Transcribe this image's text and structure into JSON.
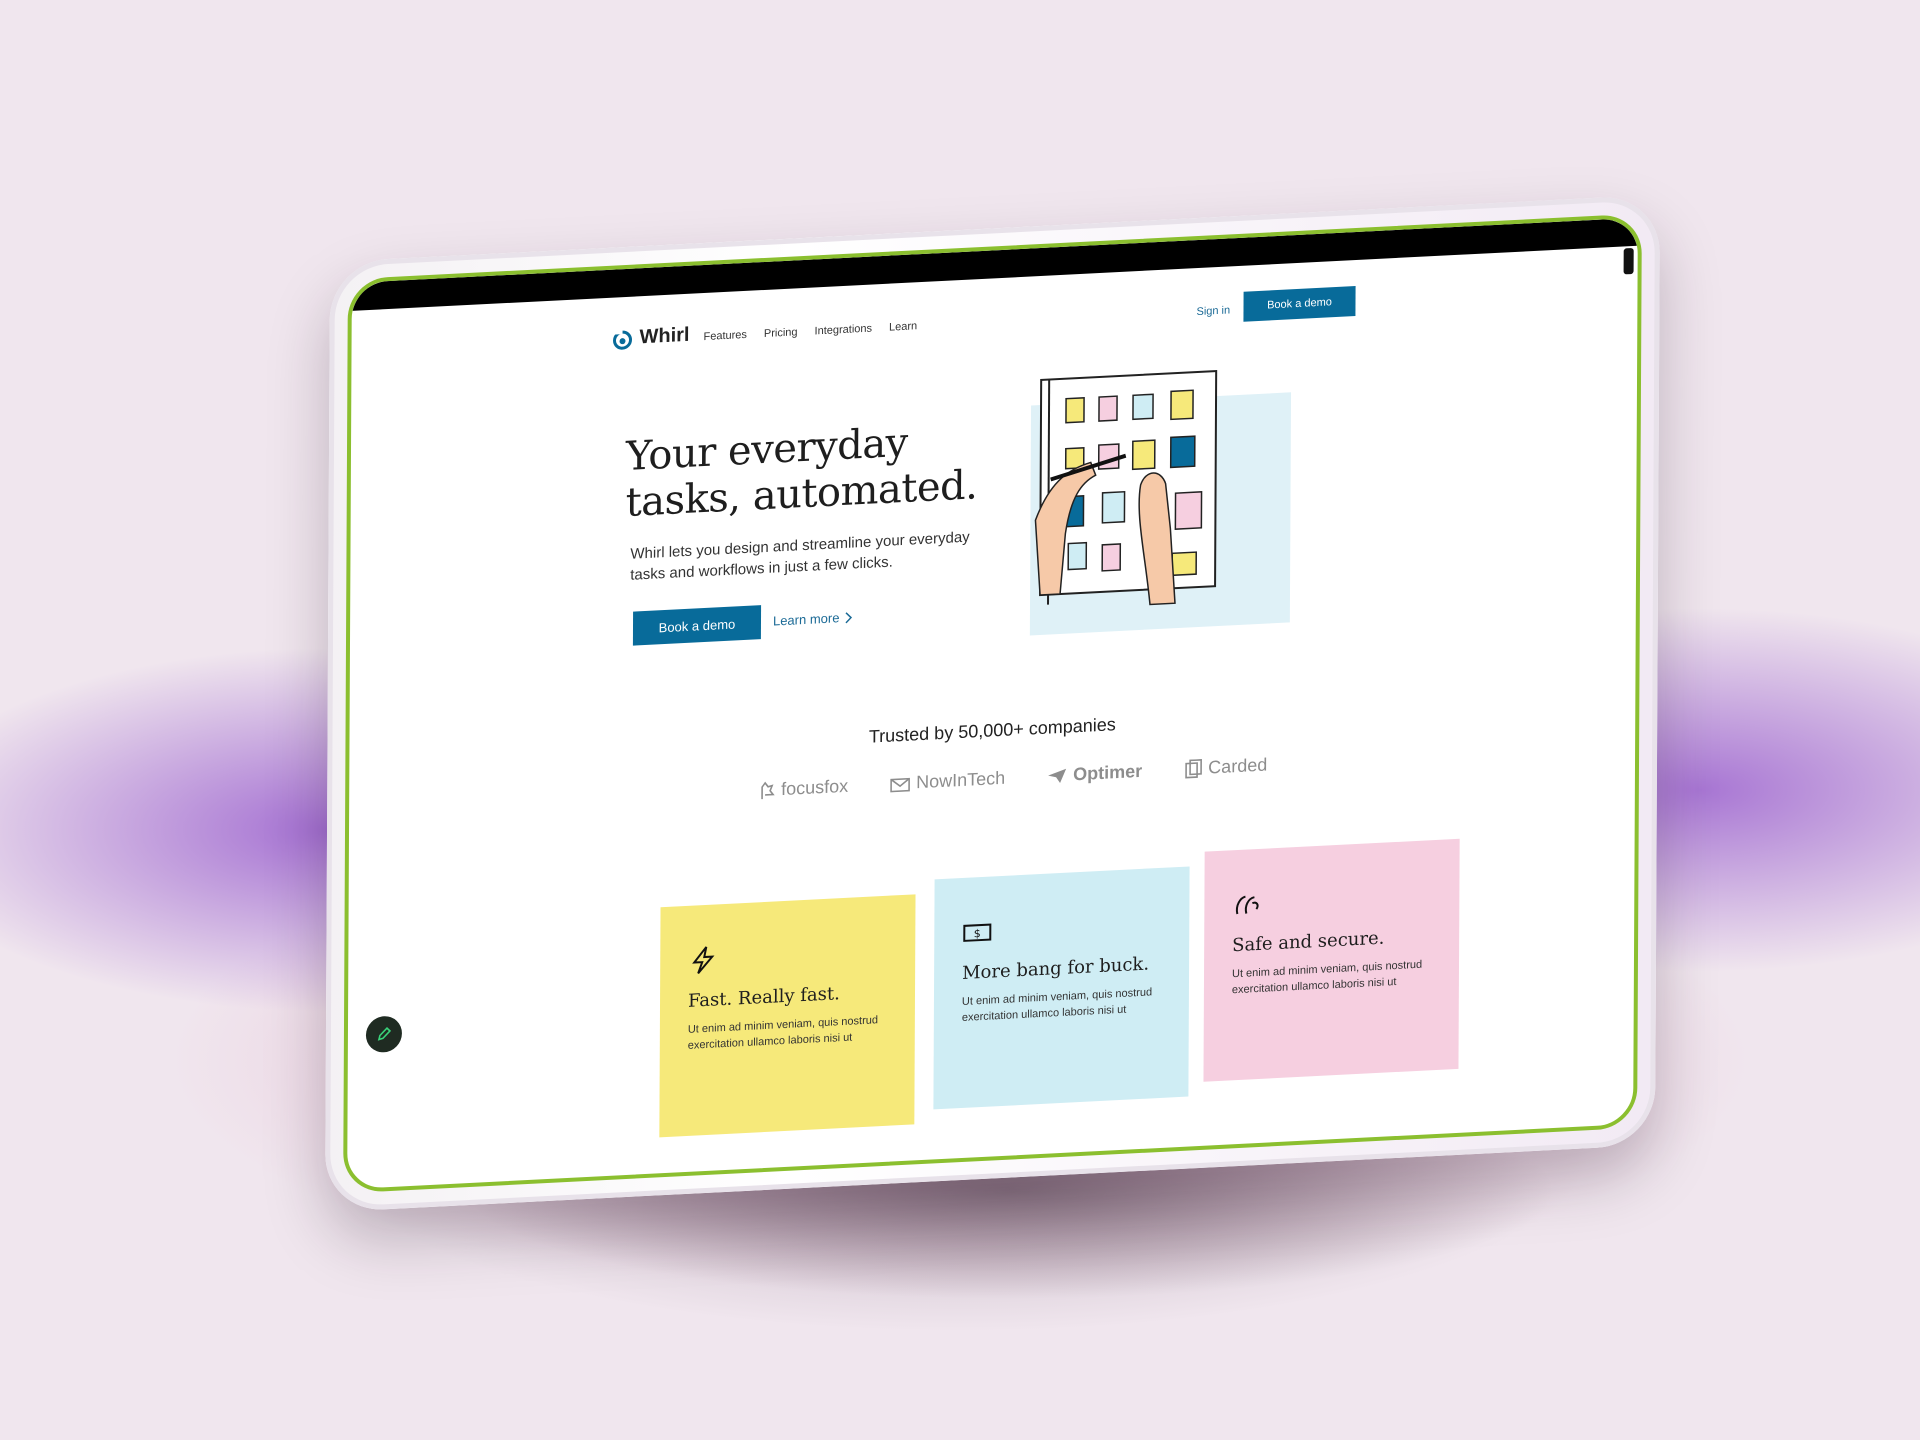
{
  "brand": {
    "name": "Whirl",
    "accent": "#086b9a",
    "frame_color": "#8bbf2f"
  },
  "nav": {
    "links": [
      "Features",
      "Pricing",
      "Integrations",
      "Learn"
    ],
    "signin": "Sign in",
    "cta": "Book a demo"
  },
  "hero": {
    "title_line1": "Your everyday",
    "title_line2": "tasks, automated.",
    "subtitle": "Whirl lets you design and streamline your everyday tasks and workflows in just a few clicks.",
    "primary_cta": "Book a demo",
    "secondary_cta": "Learn more"
  },
  "trusted": {
    "heading": "Trusted by 50,000+ companies",
    "logos": [
      "focusfox",
      "NowInTech",
      "Optimer",
      "Carded"
    ]
  },
  "features": [
    {
      "icon": "lightning-icon",
      "title": "Fast. Really fast.",
      "text": "Ut enim ad minim veniam, quis nostrud exercitation ullamco laboris nisi ut",
      "color": "#f6e97a"
    },
    {
      "icon": "money-icon",
      "title": "More bang for buck.",
      "text": "Ut enim ad minim veniam, quis nostrud exercitation ullamco laboris nisi ut",
      "color": "#cfedf4"
    },
    {
      "icon": "hands-icon",
      "title": "Safe and secure.",
      "text": "Ut enim ad minim veniam, quis nostrud exercitation ullamco laboris nisi ut",
      "color": "#f6cfe0"
    }
  ]
}
